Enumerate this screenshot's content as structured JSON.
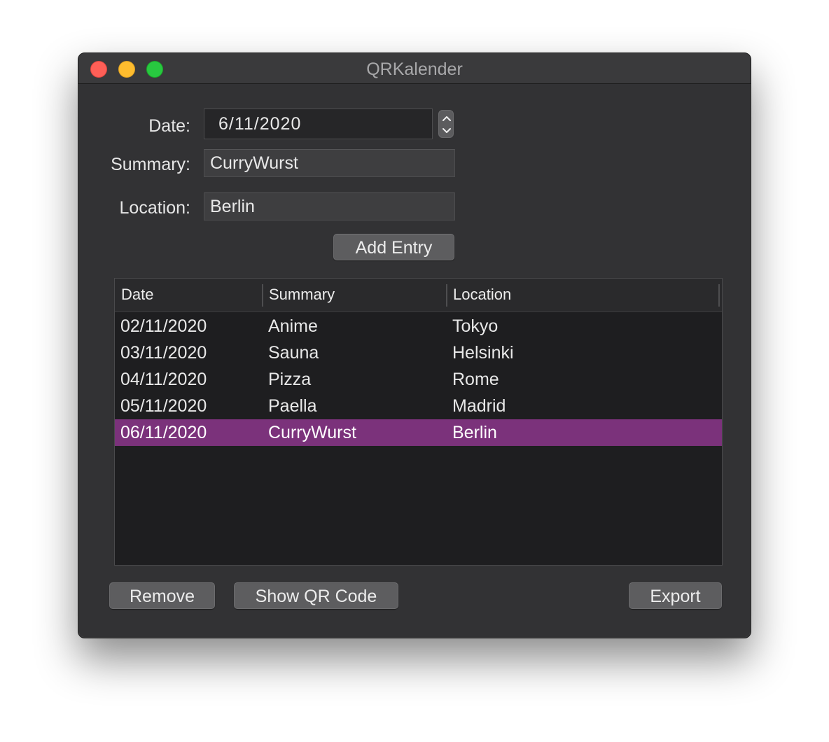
{
  "window": {
    "title": "QRKalender"
  },
  "form": {
    "date_label": "Date:",
    "date_value": "6/11/2020",
    "summary_label": "Summary:",
    "summary_value": "CurryWurst",
    "location_label": "Location:",
    "location_value": "Berlin",
    "add_button": "Add Entry"
  },
  "table": {
    "columns": [
      "Date",
      "Summary",
      "Location"
    ],
    "rows": [
      {
        "date": "02/11/2020",
        "summary": "Anime",
        "location": "Tokyo",
        "selected": false
      },
      {
        "date": "03/11/2020",
        "summary": "Sauna",
        "location": "Helsinki",
        "selected": false
      },
      {
        "date": "04/11/2020",
        "summary": "Pizza",
        "location": "Rome",
        "selected": false
      },
      {
        "date": "05/11/2020",
        "summary": "Paella",
        "location": "Madrid",
        "selected": false
      },
      {
        "date": "06/11/2020",
        "summary": "CurryWurst",
        "location": "Berlin",
        "selected": true
      }
    ],
    "selection_color": "#7b327b"
  },
  "footer": {
    "remove_button": "Remove",
    "qr_button": "Show QR Code",
    "export_button": "Export"
  },
  "icons": {
    "stepper": "up-down-stepper-icon"
  }
}
